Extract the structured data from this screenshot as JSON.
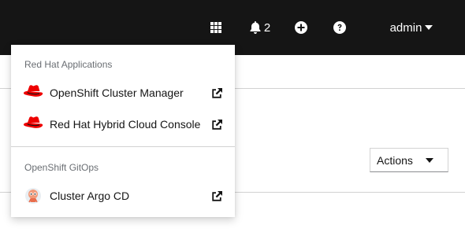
{
  "masthead": {
    "apps_icon": "grid-icon",
    "notifications": {
      "icon": "bell-icon",
      "count": "2"
    },
    "quick_create_icon": "plus-circle-icon",
    "help_icon": "question-circle-icon",
    "user": {
      "name": "admin",
      "icon": "caret-down-icon"
    }
  },
  "app_launcher": {
    "groups": [
      {
        "title": "Red Hat Applications",
        "items": [
          {
            "label": "OpenShift Cluster Manager",
            "icon": "redhat-logo-icon",
            "external_icon": "external-link-icon"
          },
          {
            "label": "Red Hat Hybrid Cloud Console",
            "icon": "redhat-logo-icon",
            "external_icon": "external-link-icon"
          }
        ]
      },
      {
        "title": "OpenShift GitOps",
        "items": [
          {
            "label": "Cluster Argo CD",
            "icon": "argo-logo-icon",
            "external_icon": "external-link-icon"
          }
        ]
      }
    ]
  },
  "page": {
    "actions_label": "Actions"
  },
  "colors": {
    "masthead_bg": "#151515",
    "redhat_red": "#ee0000",
    "text_primary": "#151515",
    "text_secondary": "#6a6e73",
    "border": "#d2d2d2"
  }
}
